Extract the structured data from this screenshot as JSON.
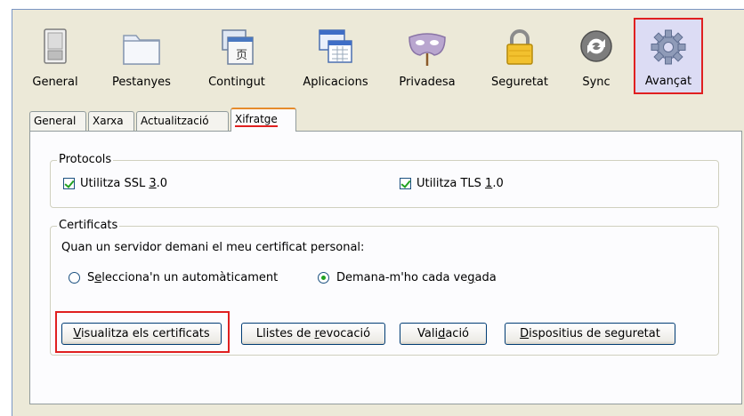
{
  "panes": [
    {
      "label": "General",
      "icon": "switch-icon"
    },
    {
      "label": "Pestanyes",
      "icon": "folder-tabs-icon"
    },
    {
      "label": "Contingut",
      "icon": "content-page-icon"
    },
    {
      "label": "Aplicacions",
      "icon": "applications-window-icon"
    },
    {
      "label": "Privadesa",
      "icon": "privacy-mask-icon"
    },
    {
      "label": "Seguretat",
      "icon": "padlock-icon"
    },
    {
      "label": "Sync",
      "icon": "sync-icon"
    },
    {
      "label": "Avançat",
      "icon": "gear-icon",
      "selected": true
    }
  ],
  "tabs": [
    {
      "label": "General"
    },
    {
      "label": "Xarxa"
    },
    {
      "label": "Actualització"
    },
    {
      "label": "Xifratge",
      "active": true
    }
  ],
  "protocols": {
    "title": "Protocols",
    "ssl_label": "Utilitza SSL 3.0",
    "tls_label": "Utilitza TLS 1.0",
    "ssl_checked": true,
    "tls_checked": true
  },
  "certificates": {
    "title": "Certificats",
    "prompt": "Quan un servidor demani el meu certificat personal:",
    "option_auto": "Selecciona'n un automàticament",
    "option_ask": "Demana-m'ho cada vegada",
    "selected_option": "ask",
    "buttons": {
      "view": "Visualitza els certificats",
      "revocation": "Llistes de revocació",
      "validation": "Validació",
      "devices": "Dispositius de seguretat"
    }
  },
  "colors": {
    "highlight": "#e02020",
    "check": "#21a121",
    "selected_pane_bg": "#dcdcf4"
  }
}
